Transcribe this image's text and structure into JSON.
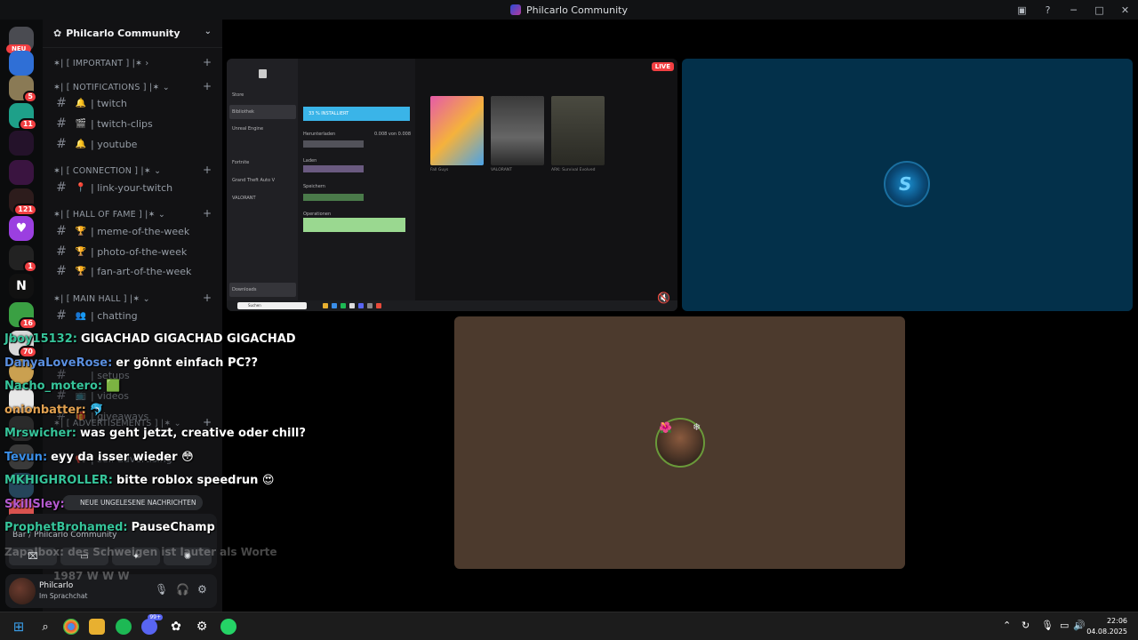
{
  "window": {
    "title": "Philcarlo Community"
  },
  "servers": {
    "neu_label": "NEU",
    "badges": [
      "5",
      "11",
      "121",
      "1",
      "16",
      "70"
    ]
  },
  "guild": {
    "name": "Philcarlo Community"
  },
  "categories": [
    {
      "label": "✶| [ IMPORTANT ] |✶ ›"
    },
    {
      "label": "✶| [ NOTIFICATIONS ] |✶ ⌄"
    },
    {
      "label": "✶| [ CONNECTION ] |✶ ⌄"
    },
    {
      "label": "✶| [ HALL OF FAME ] |✶ ⌄"
    },
    {
      "label": "✶| [ MAIN HALL ] |✶ ⌄"
    },
    {
      "label": "✶| [ ADVERTISEMENTS ] |✶ ⌄"
    }
  ],
  "channels": [
    {
      "emoji": "🔔",
      "label": "| twitch"
    },
    {
      "emoji": "🎬",
      "label": "| twitch-clips"
    },
    {
      "emoji": "🔔",
      "label": "| youtube"
    },
    {
      "emoji": "📍",
      "label": "| link-your-twitch"
    },
    {
      "emoji": "🏆",
      "label": "| meme-of-the-week"
    },
    {
      "emoji": "🏆",
      "label": "| photo-of-the-week"
    },
    {
      "emoji": "🏆",
      "label": "| fan-art-of-the-week"
    },
    {
      "emoji": "👥",
      "label": "| chatting"
    },
    {
      "emoji": "",
      "label": "| setups"
    },
    {
      "emoji": "📺",
      "label": "| videos"
    },
    {
      "emoji": "🎁",
      "label": "| giveaways"
    },
    {
      "emoji": "📢",
      "label": "| self-advertising"
    }
  ],
  "unread_label": "NEUE UNGELESENE NACHRICHTEN",
  "voice": {
    "location": "Bar / Philcarlo Community"
  },
  "user": {
    "name": "Philcarlo",
    "status": "Im Sprachchat"
  },
  "stream": {
    "live_label": "LIVE"
  },
  "epic": {
    "sidebar": [
      "Store",
      "Bibliothek",
      "Unreal Engine",
      "Fortnite",
      "Grand Theft Auto V",
      "VALORANT",
      "Downloads"
    ],
    "install_label": "33 % INSTALLIERT",
    "sections": [
      "Herunterladen",
      "Laden",
      "Speichern",
      "Operationen"
    ],
    "size_label": "0.008 von 0.008",
    "games": [
      "Fall Guys",
      "VALORANT",
      "ARK: Survival Evolved"
    ],
    "search_label": "Suchen"
  },
  "chat": [
    {
      "name": "Jboy15132:",
      "text": "GIGACHAD GIGACHAD GIGACHAD",
      "color": "#36c49a"
    },
    {
      "name": "DanyaLoveRose:",
      "text": "er gönnt einfach PC??",
      "color": "#5a8fe0"
    },
    {
      "name": "Nacho_motero:",
      "text": "🟩",
      "color": "#36c49a"
    },
    {
      "name": "onionbatter:",
      "text": "🐬",
      "color": "#e0a050"
    },
    {
      "name": "Mrswicher:",
      "text": "was geht jetzt, creative oder chill?",
      "color": "#36c49a"
    },
    {
      "name": "Tevun:",
      "text": "eyy da isser wieder 😳",
      "color": "#3a8ee8"
    },
    {
      "name": "MKHIGHROLLER:",
      "text": "bitte roblox speedrun 😍",
      "color": "#36c49a"
    },
    {
      "name": "SkillSley:",
      "text": "",
      "color": "#b45ad0"
    },
    {
      "name": "ProphetBrohamed:",
      "text": "PauseChamp",
      "color": "#36c49a"
    }
  ],
  "chat_faded": [
    "Zapalbox: des Schweigen ist lauter als Worte",
    "1987 W W W"
  ],
  "taskbar": {
    "time": "22:06",
    "date": "04.08.2025",
    "badge": "99+"
  }
}
